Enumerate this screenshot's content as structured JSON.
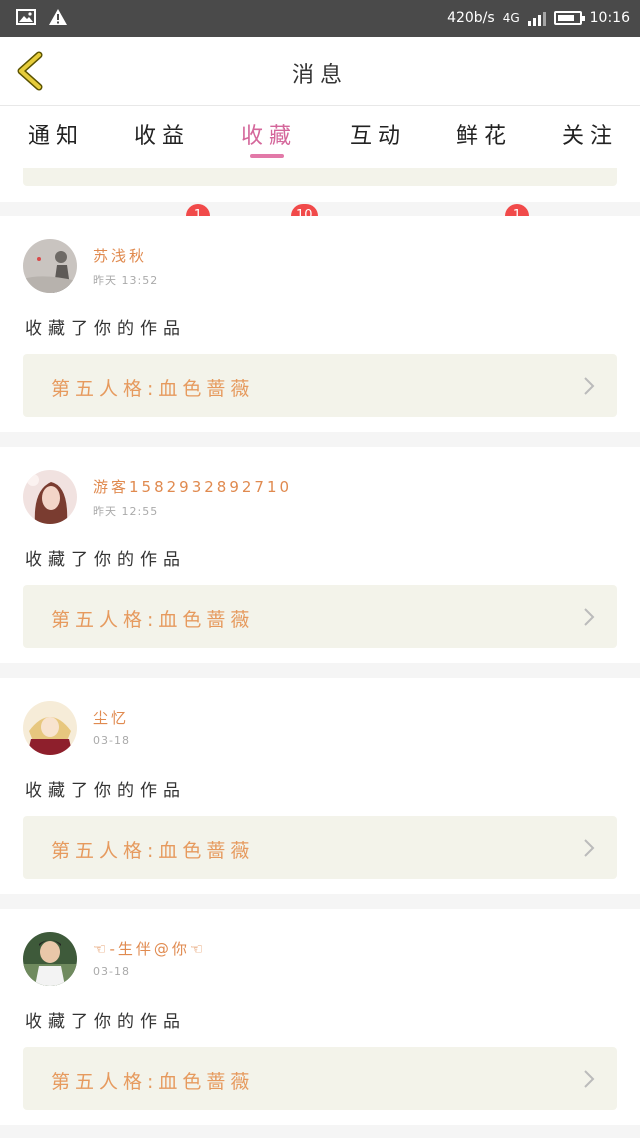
{
  "status_bar": {
    "speed": "420b/s",
    "network": "4G",
    "time": "10:16",
    "icons": [
      "image-icon",
      "warning-icon",
      "signal-icon",
      "battery-icon"
    ]
  },
  "header": {
    "title": "消息",
    "back_icon": "chevron-left-icon"
  },
  "tabs": [
    {
      "label": "通知",
      "badge": ""
    },
    {
      "label": "收益",
      "badge": "1"
    },
    {
      "label": "收藏",
      "badge": "10",
      "active": true
    },
    {
      "label": "互动",
      "badge": ""
    },
    {
      "label": "鲜花",
      "badge": "1"
    },
    {
      "label": "关注",
      "badge": ""
    }
  ],
  "colors": {
    "accent": "#e279a8",
    "username": "#e08a4f",
    "work_title": "#e69a5e",
    "badge": "#f14a4a",
    "back_arrow": "#e6cc3a",
    "work_bg": "#f3f3ea"
  },
  "messages": [
    {
      "user": "苏浅秋",
      "time": "昨天 13:52",
      "action": "收藏了你的作品",
      "work": "第五人格:血色蔷薇"
    },
    {
      "user": "游客1582932892710",
      "time": "昨天 12:55",
      "action": "收藏了你的作品",
      "work": "第五人格:血色蔷薇"
    },
    {
      "user": "尘忆",
      "time": "03-18",
      "action": "收藏了你的作品",
      "work": "第五人格:血色蔷薇"
    },
    {
      "user": "☜-生伴@你☜",
      "time": "03-18",
      "action": "收藏了你的作品",
      "work": "第五人格:血色蔷薇"
    }
  ]
}
